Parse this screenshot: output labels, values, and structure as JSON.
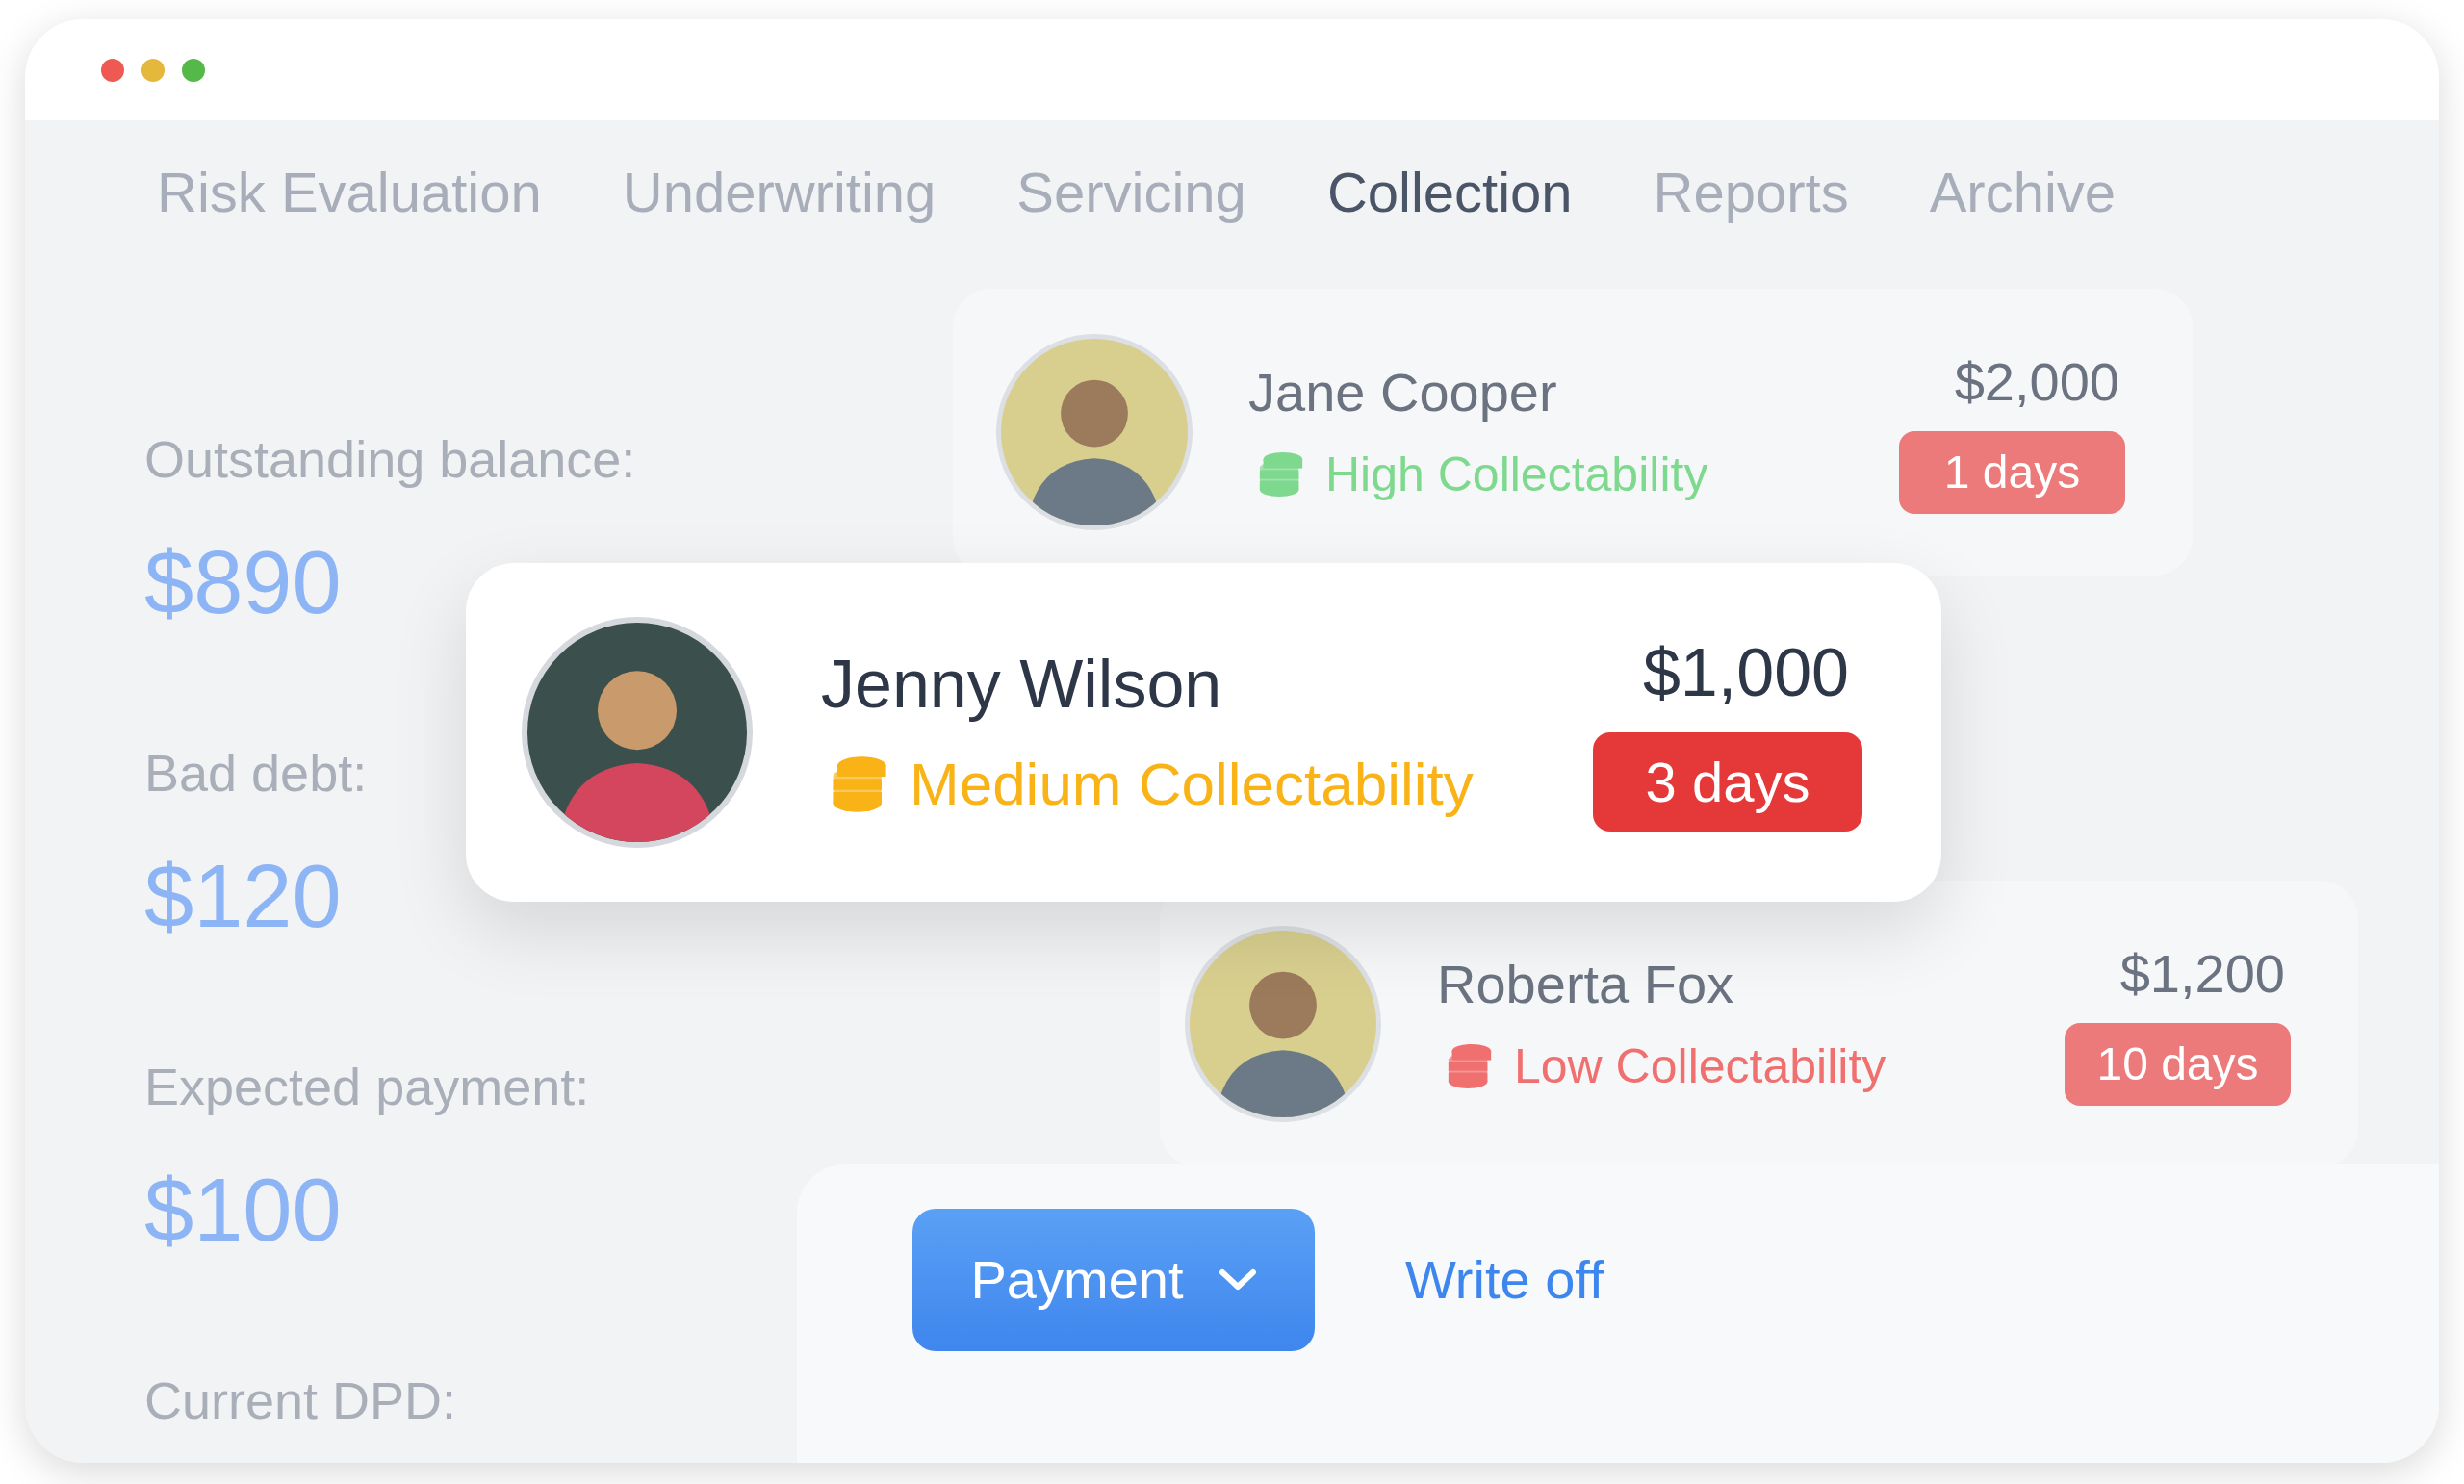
{
  "tabs": [
    {
      "label": "Risk Evaluation",
      "selected": false
    },
    {
      "label": "Underwriting",
      "selected": false
    },
    {
      "label": "Servicing",
      "selected": false
    },
    {
      "label": "Collection",
      "selected": true
    },
    {
      "label": "Reports",
      "selected": false
    },
    {
      "label": "Archive",
      "selected": false
    }
  ],
  "summary": [
    {
      "label": "Outstanding balance:",
      "value": "$890"
    },
    {
      "label": "Bad debt:",
      "value": "$120"
    },
    {
      "label": "Expected payment:",
      "value": "$100"
    },
    {
      "label": "Current DPD:"
    }
  ],
  "customers": [
    {
      "name": "Jane Cooper",
      "amount": "$2,000",
      "collectability": "High Collectability",
      "color": "#7ed98f",
      "overdue": "1 days",
      "focused": false
    },
    {
      "name": "Jenny Wilson",
      "amount": "$1,000",
      "collectability": "Medium Collectability",
      "color": "#f9b317",
      "overdue": "3 days",
      "focused": true
    },
    {
      "name": "Roberta Fox",
      "amount": "$1,200",
      "collectability": "Low Collectability",
      "color": "#f07070",
      "overdue": "10 days",
      "focused": false
    }
  ],
  "actions": [
    {
      "label": "Payment",
      "kind": "dropdown"
    },
    {
      "label": "Write off",
      "kind": "link"
    }
  ]
}
